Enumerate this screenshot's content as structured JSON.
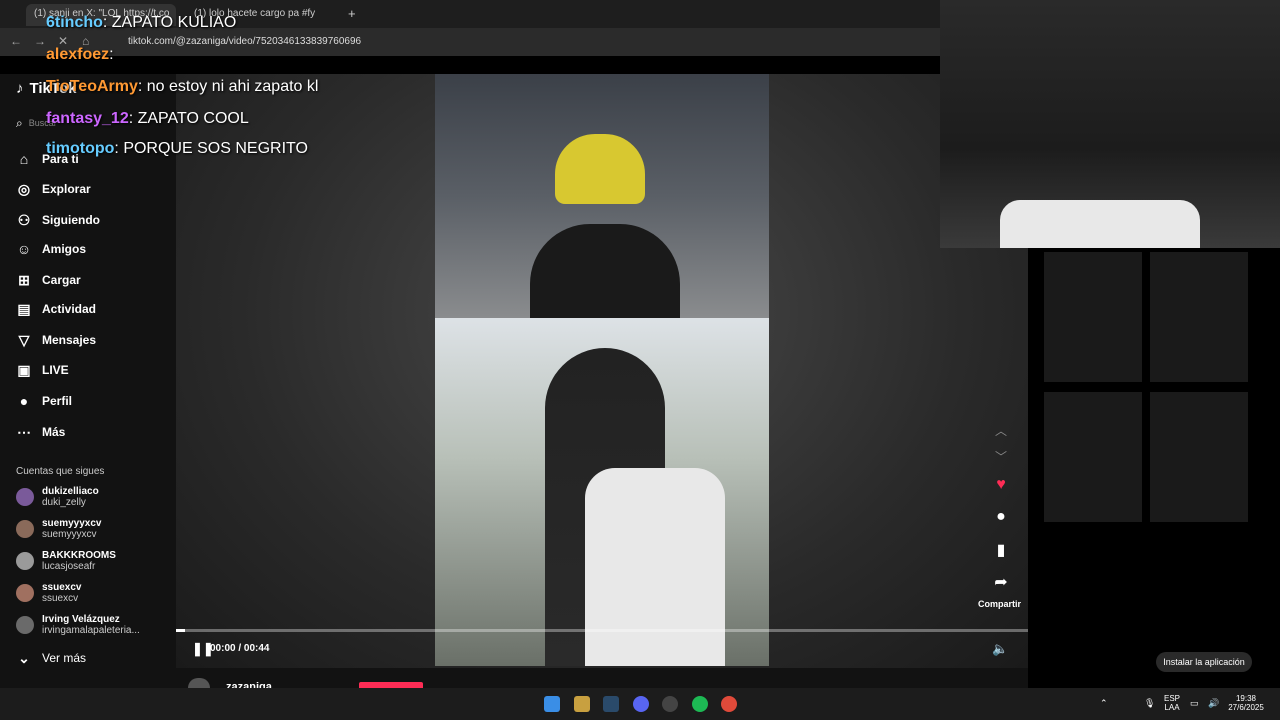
{
  "browser": {
    "tabs": [
      {
        "label": "(1) sanji en X: \"LOL https://t.co"
      },
      {
        "label": "(1) lolo hacete cargo pa #fy"
      }
    ],
    "url": "tiktok.com/@zazaniga/video/7520346133839760696"
  },
  "chat": [
    {
      "user": "6tincho",
      "message": "ZAPATO KULIAO",
      "color": "#66ccff"
    },
    {
      "user": "alexfoez",
      "message": "",
      "color": "#ff9933"
    },
    {
      "user": "TioTeoArmy",
      "message": "no estoy ni ahi zapato kl",
      "color": "#ff9933"
    },
    {
      "user": "fantasy_12",
      "message": "ZAPATO COOL",
      "color": "#cc66ff"
    },
    {
      "user": "timotopo",
      "message": "PORQUE SOS NEGRITO",
      "color": "#66ccff"
    }
  ],
  "sidebar": {
    "logo": "TikTok",
    "search_placeholder": "Buscar",
    "items": [
      {
        "label": "Para ti",
        "icon": "home-icon"
      },
      {
        "label": "Explorar",
        "icon": "compass-icon"
      },
      {
        "label": "Siguiendo",
        "icon": "following-icon"
      },
      {
        "label": "Amigos",
        "icon": "friends-icon"
      },
      {
        "label": "Cargar",
        "icon": "upload-icon"
      },
      {
        "label": "Actividad",
        "icon": "activity-icon"
      },
      {
        "label": "Mensajes",
        "icon": "messages-icon"
      },
      {
        "label": "LIVE",
        "icon": "live-icon"
      },
      {
        "label": "Perfil",
        "icon": "profile-icon"
      },
      {
        "label": "Más",
        "icon": "more-icon"
      }
    ],
    "following_title": "Cuentas que sigues",
    "following": [
      {
        "name": "dukizelliaco",
        "user": "duki_zelly"
      },
      {
        "name": "suemyyyxcv",
        "user": "suemyyyxcv"
      },
      {
        "name": "BAKKKROOMS",
        "user": "lucasjoseafr"
      },
      {
        "name": "ssuexcv",
        "user": "ssuexcv"
      },
      {
        "name": "Irving Velázquez",
        "user": "irvingamalapaleteria..."
      }
    ],
    "see_more": "Ver más"
  },
  "player": {
    "time": "00:00 / 00:44",
    "progress": 0.01,
    "author": "zazaniga",
    "share_label": "Compartir",
    "install_label": "Instalar la aplicación"
  },
  "taskbar": {
    "lang": "ESP",
    "layout": "LAA",
    "clock": "19:38",
    "date": "27/6/2025"
  }
}
